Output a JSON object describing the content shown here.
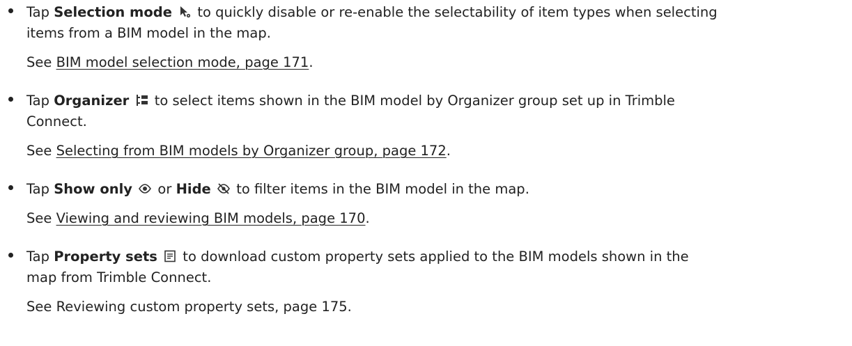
{
  "items": [
    {
      "tap": "Tap ",
      "label": "Selection mode",
      "icon": "cursor-gear-icon",
      "line1_rest": " to quickly disable or re-enable the selectability of item types when selecting",
      "line2": "items from a BIM model in the map.",
      "see_prefix": "See ",
      "see_link": "BIM model selection mode, page 171",
      "see_suffix": "."
    },
    {
      "tap": "Tap ",
      "label": "Organizer",
      "icon": "organizer-tree-icon",
      "line1_rest": " to select items shown in the BIM model by Organizer group set up in Trimble",
      "line2": "Connect.",
      "see_prefix": "See ",
      "see_link": "Selecting from BIM models by Organizer group, page 172",
      "see_suffix": "."
    },
    {
      "tap": "Tap ",
      "label": "Show only",
      "icon": "eye-icon",
      "mid": " or ",
      "label2": "Hide",
      "icon2": "eye-slash-icon",
      "line1_rest": " to filter items in the BIM model in the map.",
      "see_prefix": "See ",
      "see_link": "Viewing and reviewing BIM models, page 170",
      "see_suffix": "."
    },
    {
      "tap": "Tap ",
      "label": "Property sets",
      "icon": "property-sets-icon",
      "line1_rest": " to download custom property sets applied to the BIM models shown in the",
      "line2": "map from Trimble Connect.",
      "see_text": "See Reviewing custom property sets, page 175."
    }
  ]
}
